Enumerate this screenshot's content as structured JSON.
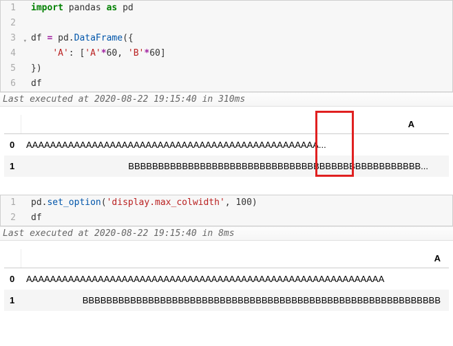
{
  "cell1": {
    "lines": {
      "l1_kw_import": "import",
      "l1_pandas": " pandas ",
      "l1_kw_as": "as",
      "l1_pd": " pd",
      "l3_df": "df ",
      "l3_eq": "=",
      "l3_pd": " pd.",
      "l3_fn": "DataFrame",
      "l3_open": "({",
      "l4_indent": "    ",
      "l4_key": "'A'",
      "l4_colon": ": [",
      "l4_astr": "'A'",
      "l4_mul1": "*",
      "l4_sixty1": "60, ",
      "l4_bstr": "'B'",
      "l4_mul2": "*",
      "l4_sixty2": "60]",
      "l5_close": "})",
      "l6_df": "df"
    },
    "numbers": [
      "1",
      "2",
      "3",
      "4",
      "5",
      "6"
    ],
    "status": "Last executed at 2020-08-22 19:15:40 in 310ms"
  },
  "output1": {
    "col_header": "A",
    "rows": [
      {
        "idx": "0",
        "val": "AAAAAAAAAAAAAAAAAAAAAAAAAAAAAAAAAAAAAAAAAAAAAAAAA..."
      },
      {
        "idx": "1",
        "val": "BBBBBBBBBBBBBBBBBBBBBBBBBBBBBBBBBBBBBBBBBBBBBBBBB..."
      }
    ]
  },
  "cell2": {
    "lines": {
      "l1_pd": "pd.",
      "l1_fn": "set_option",
      "l1_open": "(",
      "l1_str": "'display.max_colwidth'",
      "l1_rest": ", 100)",
      "l2_df": "df"
    },
    "numbers": [
      "1",
      "2"
    ],
    "status": "Last executed at 2020-08-22 19:15:40 in 8ms"
  },
  "output2": {
    "col_header": "A",
    "rows": [
      {
        "idx": "0",
        "val": "AAAAAAAAAAAAAAAAAAAAAAAAAAAAAAAAAAAAAAAAAAAAAAAAAAAAAAAAAAAA"
      },
      {
        "idx": "1",
        "val": "BBBBBBBBBBBBBBBBBBBBBBBBBBBBBBBBBBBBBBBBBBBBBBBBBBBBBBBBBBBB"
      }
    ]
  }
}
